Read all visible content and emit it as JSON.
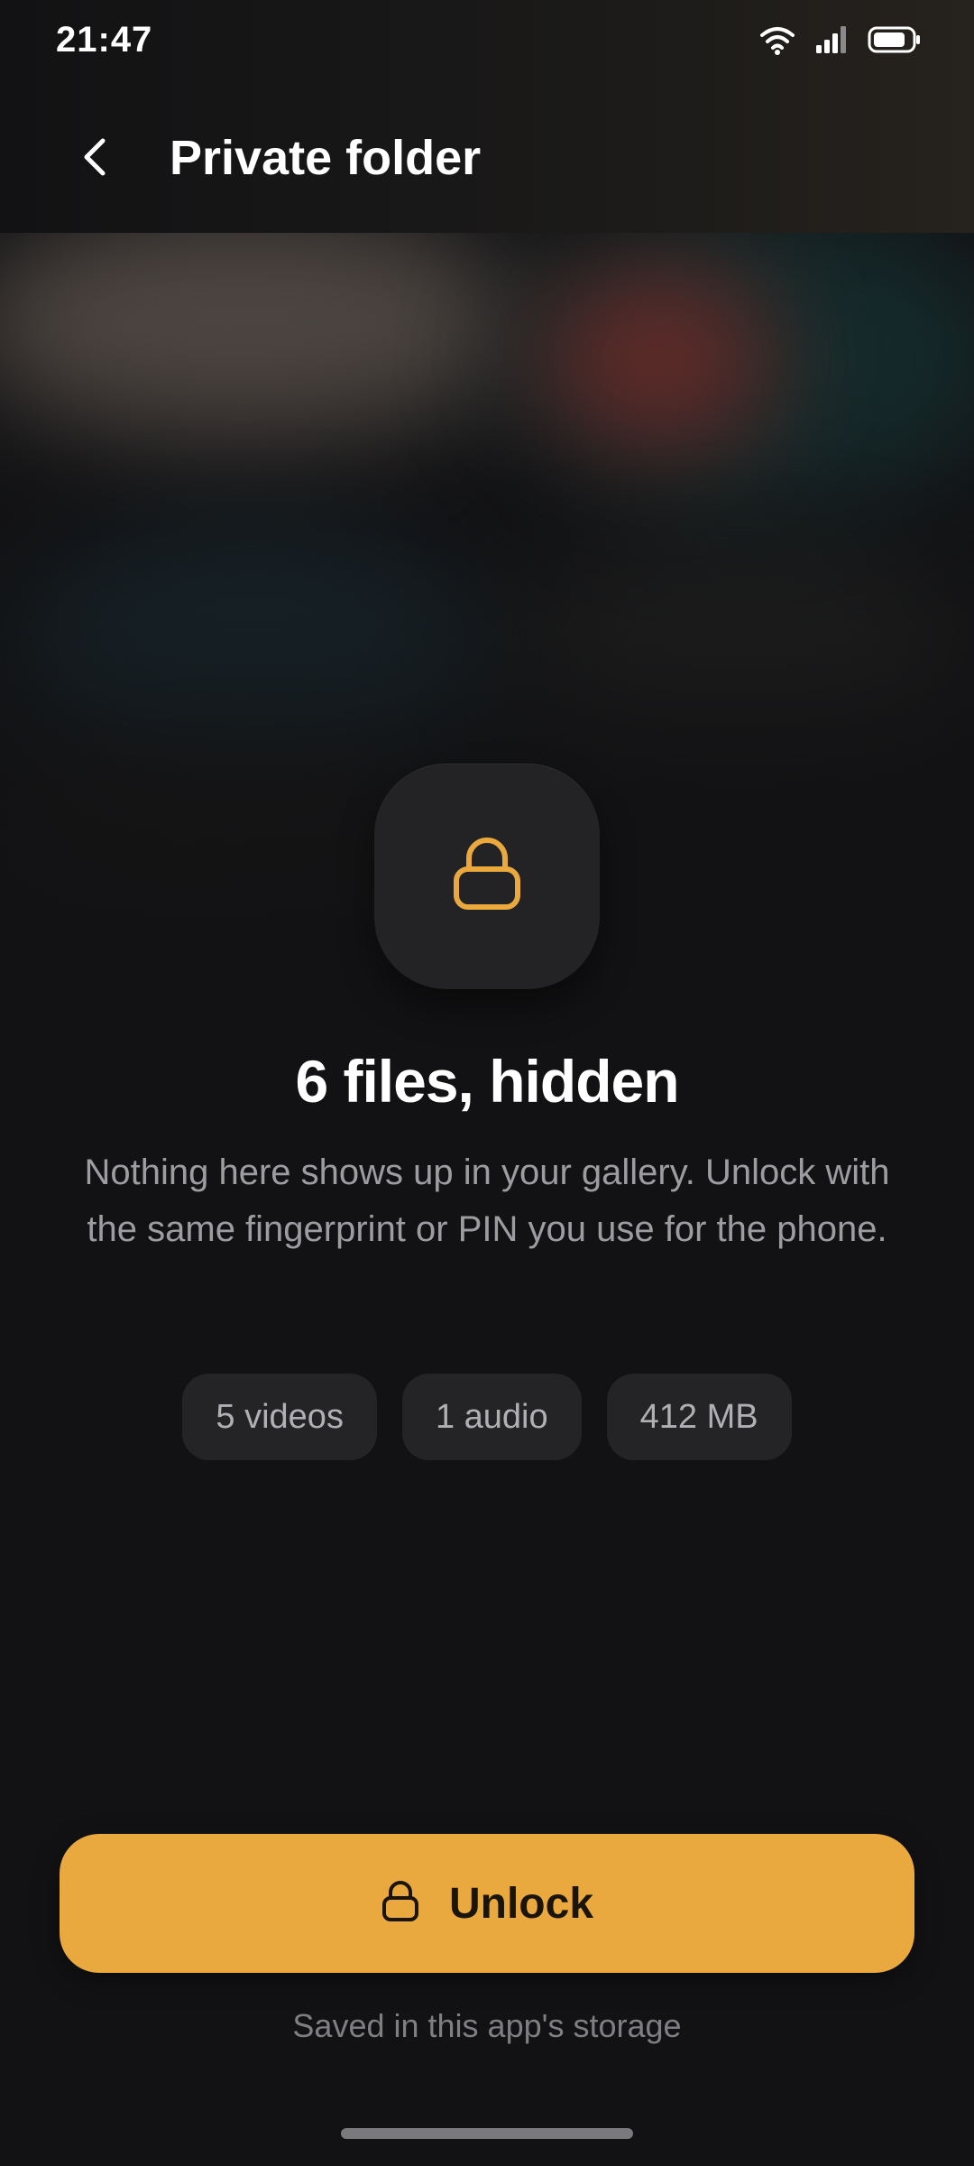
{
  "status_bar": {
    "time": "21:47",
    "icons": [
      "wifi-icon",
      "signal-icon",
      "battery-icon"
    ]
  },
  "header": {
    "back_icon": "chevron-left-icon",
    "title": "Private folder"
  },
  "lock_icon": "lock-icon",
  "heading": "6 files, hidden",
  "description": "Nothing here shows up in your gallery. Unlock with the same fingerprint or PIN you use for the phone.",
  "chips": [
    {
      "label": "5 videos"
    },
    {
      "label": "1 audio"
    },
    {
      "label": "412 MB"
    }
  ],
  "unlock_button": {
    "icon": "lock-icon",
    "label": "Unlock"
  },
  "storage_note": "Saved in this app's storage",
  "colors": {
    "accent": "#e9a93f",
    "background": "#121214",
    "tile": "#232326",
    "chip": "#242427"
  }
}
